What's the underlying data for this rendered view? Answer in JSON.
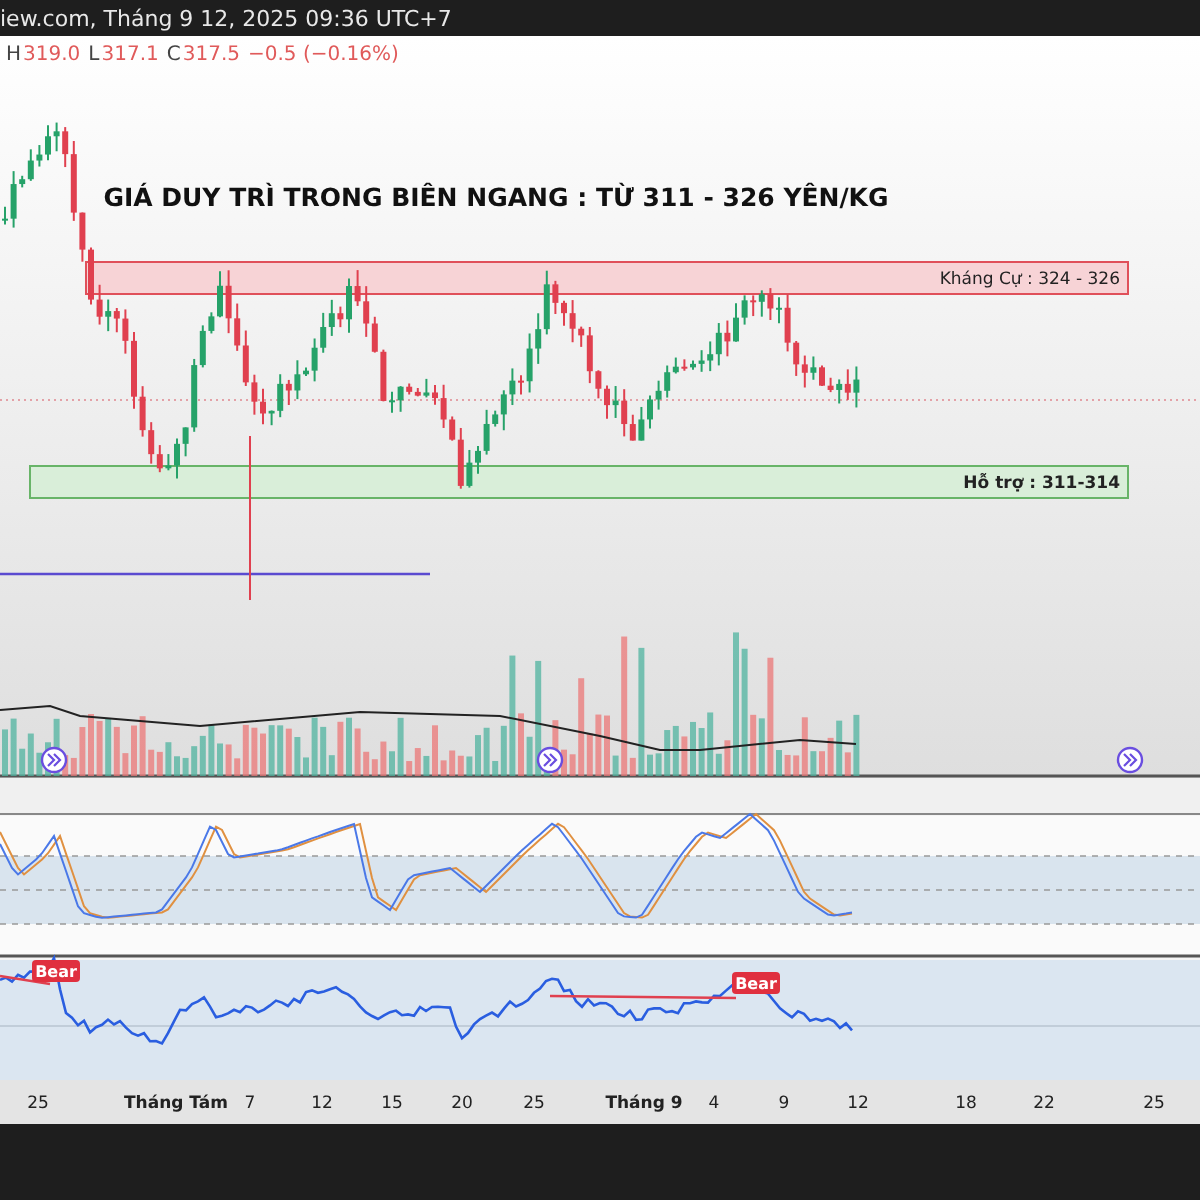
{
  "header": {
    "source": "iew.com, Tháng 9 12, 2025 09:36 UTC+7"
  },
  "ohlc": [
    {
      "label": "H",
      "value": "319.0"
    },
    {
      "label": "L",
      "value": "317.1"
    },
    {
      "label": "C",
      "value": "317.5"
    }
  ],
  "change": "−0.5 (−0.16%)",
  "title": "GIÁ DUY TRÌ TRONG BIÊN NGANG : TỪ 311 - 326 YÊN/KG",
  "zones": [
    {
      "kind": "resistance",
      "label": "Kháng Cự : 324 - 326"
    },
    {
      "kind": "support",
      "label": "Hỗ trợ : 311-314"
    }
  ],
  "signals": [
    {
      "label": "Bear"
    },
    {
      "label": "Bear"
    }
  ],
  "time_axis": [
    "25",
    "Tháng Tám",
    "7",
    "12",
    "15",
    "20",
    "25",
    "Tháng 9",
    "4",
    "9",
    "12",
    "18",
    "22",
    "25"
  ]
}
